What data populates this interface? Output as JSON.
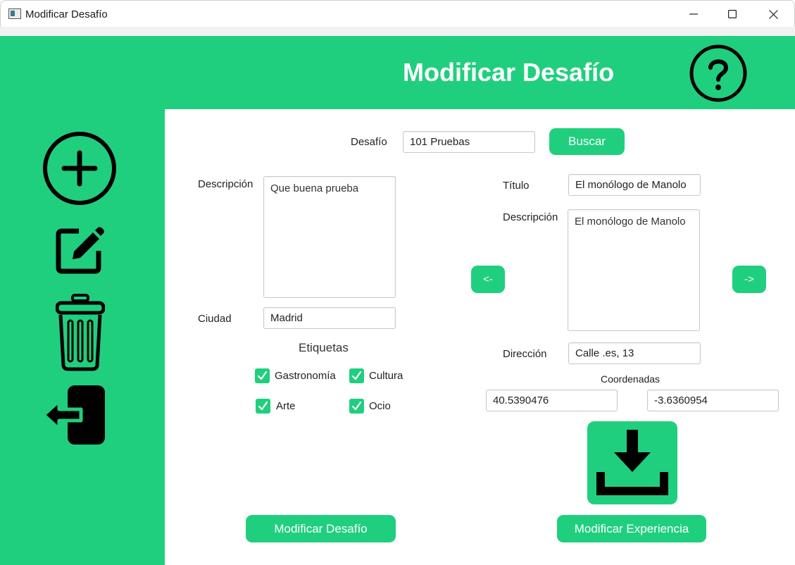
{
  "window": {
    "title": "Modificar Desafío",
    "controls": [
      "minimize-icon",
      "maximize-icon",
      "close-icon"
    ]
  },
  "header": {
    "title": "Modificar Desafío",
    "help_icon": "question-circle-icon"
  },
  "sidebar": {
    "items": [
      {
        "name": "add",
        "icon": "plus-circle-icon"
      },
      {
        "name": "edit",
        "icon": "edit-icon"
      },
      {
        "name": "delete",
        "icon": "trash-icon"
      },
      {
        "name": "exit",
        "icon": "logout-icon"
      }
    ]
  },
  "search": {
    "label": "Desafío",
    "value": "101 Pruebas",
    "button_label": "Buscar"
  },
  "challenge": {
    "description_label": "Descripción",
    "description_value": "Que buena prueba",
    "city_label": "Ciudad",
    "city_value": "Madrid",
    "tags_title": "Etiquetas",
    "tags": [
      {
        "label": "Gastronomía",
        "checked": true
      },
      {
        "label": "Cultura",
        "checked": true
      },
      {
        "label": "Arte",
        "checked": true
      },
      {
        "label": "Ocio",
        "checked": true
      }
    ],
    "submit_label": "Modificar Desafío"
  },
  "experience": {
    "prev_label": "<-",
    "next_label": "->",
    "title_label": "Título",
    "title_value": "El monólogo de Manolo",
    "description_label": "Descripción",
    "description_value": "El monólogo de Manolo",
    "address_label": "Dirección",
    "address_value": "Calle .es, 13",
    "coords_label": "Coordenadas",
    "lat_value": "40.5390476",
    "lon_value": "-3.6360954",
    "download_icon": "download-icon",
    "submit_label": "Modificar Experiencia"
  },
  "colors": {
    "accent": "#20cf7e",
    "icon": "#000000",
    "background": "#ffffff"
  }
}
